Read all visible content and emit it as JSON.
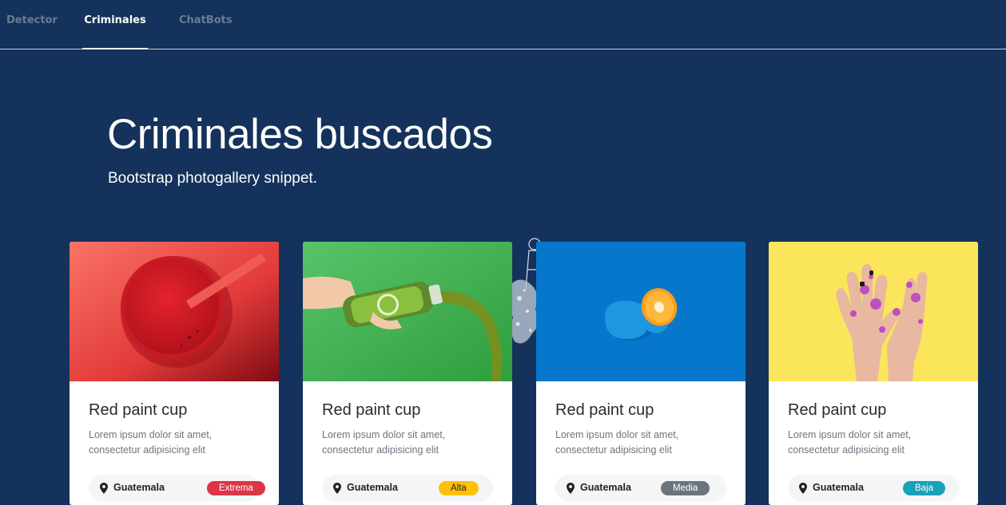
{
  "nav": {
    "tabs": [
      {
        "label": "Detector"
      },
      {
        "label": "Criminales"
      },
      {
        "label": "ChatBots"
      }
    ]
  },
  "hero": {
    "title": "Criminales buscados",
    "subtitle": "Bootstrap photogallery snippet."
  },
  "cards": [
    {
      "title": "Red paint cup",
      "desc": "Lorem ipsum dolor sit amet, consectetur adipisicing elit",
      "location": "Guatemala",
      "badge": "Extrema",
      "badge_color": "#dc3545",
      "image": "red-smoothie-cup"
    },
    {
      "title": "Red paint cup",
      "desc": "Lorem ipsum dolor sit amet, consectetur adipisicing elit",
      "location": "Guatemala",
      "badge": "Alta",
      "badge_color": "#ffc107",
      "image": "green-juice-bottle"
    },
    {
      "title": "Red paint cup",
      "desc": "Lorem ipsum dolor sit amet, consectetur adipisicing elit",
      "location": "Guatemala",
      "badge": "Media",
      "badge_color": "#6c757d",
      "image": "blue-orange"
    },
    {
      "title": "Red paint cup",
      "desc": "Lorem ipsum dolor sit amet, consectetur adipisicing elit",
      "location": "Guatemala",
      "badge": "Baja",
      "badge_color": "#17a2b8",
      "image": "glitter-hands"
    }
  ],
  "icons": {
    "location": "map-marker-icon"
  }
}
